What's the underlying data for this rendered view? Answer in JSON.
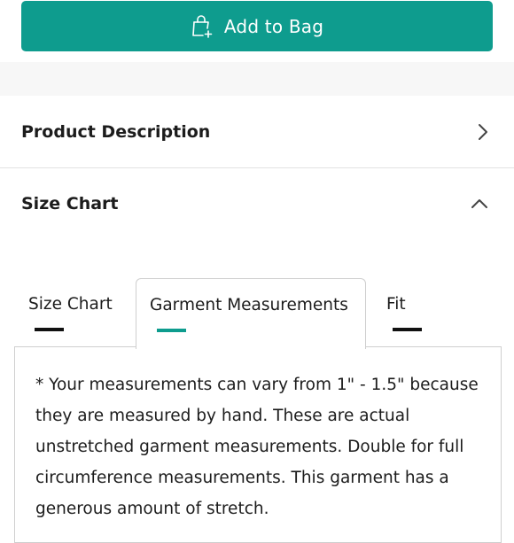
{
  "add_to_bag": {
    "label": "Add to Bag",
    "icon": "shopping-bag-plus-icon",
    "color": "#0e9c8e"
  },
  "accordion": {
    "description": {
      "title": "Product Description",
      "icon": "chevron-right-icon",
      "expanded": false
    },
    "size_chart": {
      "title": "Size Chart",
      "icon": "chevron-up-icon",
      "expanded": true
    }
  },
  "tabs": [
    {
      "label": "Size Chart",
      "active": false
    },
    {
      "label": "Garment Measurements",
      "active": true
    },
    {
      "label": "Fit",
      "active": false
    }
  ],
  "active_accent": "#0e9c8e",
  "panel": {
    "text": "* Your measurements can vary from 1\" - 1.5\" because they are measured by hand. These are actual unstretched garment measurements. Double for full circumference measurements. This garment has a generous amount of stretch."
  }
}
